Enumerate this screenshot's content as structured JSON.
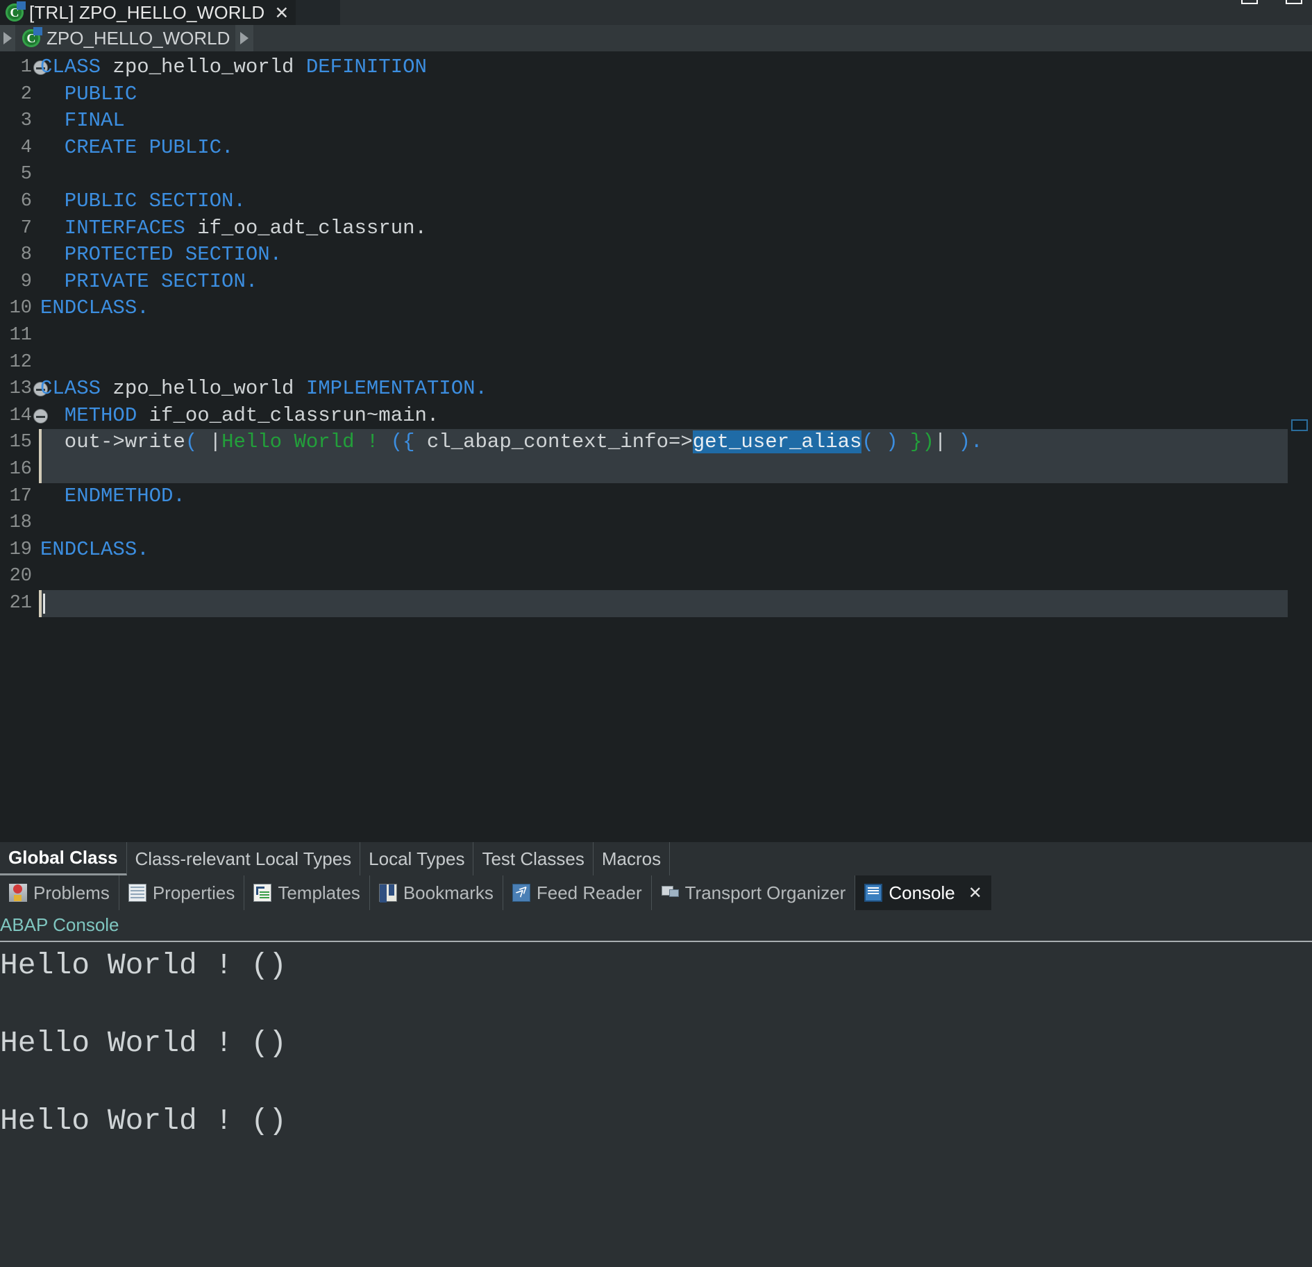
{
  "window": {
    "controls": [
      "restore-button",
      "maximize-button"
    ]
  },
  "editor_tab": {
    "icon": "abap-class-icon",
    "title": "[TRL] ZPO_HELLO_WORLD",
    "close_label": "✕"
  },
  "breadcrumb": {
    "left_arrow": "breadcrumb-left-arrow-icon",
    "icon": "abap-global-class-icon",
    "label": "ZPO_HELLO_WORLD",
    "right_arrow": "breadcrumb-right-arrow-icon"
  },
  "code": {
    "language": "ABAP",
    "lines": [
      {
        "n": "1",
        "fold": true,
        "segments": [
          {
            "t": "CLASS ",
            "c": "kw"
          },
          {
            "t": "zpo_hello_world ",
            "c": "pl"
          },
          {
            "t": "DEFINITION",
            "c": "kw"
          }
        ]
      },
      {
        "n": "2",
        "fold": false,
        "segments": [
          {
            "t": "  PUBLIC",
            "c": "kw"
          }
        ]
      },
      {
        "n": "3",
        "fold": false,
        "segments": [
          {
            "t": "  FINAL",
            "c": "kw"
          }
        ]
      },
      {
        "n": "4",
        "fold": false,
        "segments": [
          {
            "t": "  CREATE PUBLIC.",
            "c": "kw"
          }
        ]
      },
      {
        "n": "5",
        "fold": false,
        "segments": []
      },
      {
        "n": "6",
        "fold": false,
        "segments": [
          {
            "t": "  PUBLIC SECTION.",
            "c": "kw"
          }
        ]
      },
      {
        "n": "7",
        "fold": false,
        "segments": [
          {
            "t": "  INTERFACES ",
            "c": "kw"
          },
          {
            "t": "if_oo_adt_classrun.",
            "c": "pl"
          }
        ]
      },
      {
        "n": "8",
        "fold": false,
        "segments": [
          {
            "t": "  PROTECTED SECTION.",
            "c": "kw"
          }
        ]
      },
      {
        "n": "9",
        "fold": false,
        "segments": [
          {
            "t": "  PRIVATE SECTION.",
            "c": "kw"
          }
        ]
      },
      {
        "n": "10",
        "fold": false,
        "segments": [
          {
            "t": "ENDCLASS.",
            "c": "kw"
          }
        ]
      },
      {
        "n": "11",
        "fold": false,
        "segments": []
      },
      {
        "n": "12",
        "fold": false,
        "segments": []
      },
      {
        "n": "13",
        "fold": true,
        "segments": [
          {
            "t": "CLASS ",
            "c": "kw"
          },
          {
            "t": "zpo_hello_world ",
            "c": "pl"
          },
          {
            "t": "IMPLEMENTATION.",
            "c": "kw"
          }
        ]
      },
      {
        "n": "14",
        "fold": true,
        "segments": [
          {
            "t": "  METHOD ",
            "c": "kw"
          },
          {
            "t": "if_oo_adt_classrun~main.",
            "c": "pl"
          }
        ]
      },
      {
        "n": "15",
        "fold": false,
        "segments": [
          {
            "t": "  out->",
            "c": "pl"
          },
          {
            "t": "write",
            "c": "pl"
          },
          {
            "t": "(",
            "c": "kw"
          },
          {
            "t": " |",
            "c": "pl"
          },
          {
            "t": "Hello World ! ",
            "c": "str"
          },
          {
            "t": "({",
            "c": "kw"
          },
          {
            "t": " cl_abap_context_info=>",
            "c": "pl"
          },
          {
            "t": "get_user_alias",
            "c": "sel"
          },
          {
            "t": "( ) ",
            "c": "kw"
          },
          {
            "t": "})",
            "c": "grn"
          },
          {
            "t": "|",
            "c": "pl"
          },
          {
            "t": " )",
            "c": "kw"
          },
          {
            "t": ".",
            "c": "kw"
          }
        ]
      },
      {
        "n": "16",
        "fold": false,
        "segments": []
      },
      {
        "n": "17",
        "fold": false,
        "segments": [
          {
            "t": "  ENDMETHOD.",
            "c": "kw"
          }
        ]
      },
      {
        "n": "18",
        "fold": false,
        "segments": []
      },
      {
        "n": "19",
        "fold": false,
        "segments": [
          {
            "t": "ENDCLASS.",
            "c": "kw"
          }
        ]
      },
      {
        "n": "20",
        "fold": false,
        "segments": []
      },
      {
        "n": "21",
        "fold": false,
        "segments": []
      }
    ],
    "selection_text": "get_user_alias",
    "current_line": "21",
    "colors": {
      "background": "#1c2022",
      "keyword": "#3c8ee0",
      "plain": "#d0d4d6",
      "string": "#22a03a",
      "selection": "#1f6ba6",
      "current_line_highlight": "#353c41",
      "line_number": "#8b8f8f"
    }
  },
  "source_tabs": [
    {
      "label": "Global Class",
      "active": true
    },
    {
      "label": "Class-relevant Local Types",
      "active": false
    },
    {
      "label": "Local Types",
      "active": false
    },
    {
      "label": "Test Classes",
      "active": false
    },
    {
      "label": "Macros",
      "active": false
    }
  ],
  "view_tabs": [
    {
      "label": "Problems",
      "icon": "problems-icon",
      "active": false
    },
    {
      "label": "Properties",
      "icon": "properties-icon",
      "active": false
    },
    {
      "label": "Templates",
      "icon": "templates-icon",
      "active": false
    },
    {
      "label": "Bookmarks",
      "icon": "bookmarks-icon",
      "active": false
    },
    {
      "label": "Feed Reader",
      "icon": "feed-reader-icon",
      "active": false
    },
    {
      "label": "Transport Organizer",
      "icon": "transport-organizer-icon",
      "active": false
    },
    {
      "label": "Console",
      "icon": "console-icon",
      "active": true,
      "close_label": "✕"
    }
  ],
  "console": {
    "title": "ABAP Console",
    "title_color": "#7fc6c0",
    "output": [
      "Hello World ! ()",
      "",
      "Hello World ! ()",
      "",
      "Hello World ! ()"
    ]
  }
}
